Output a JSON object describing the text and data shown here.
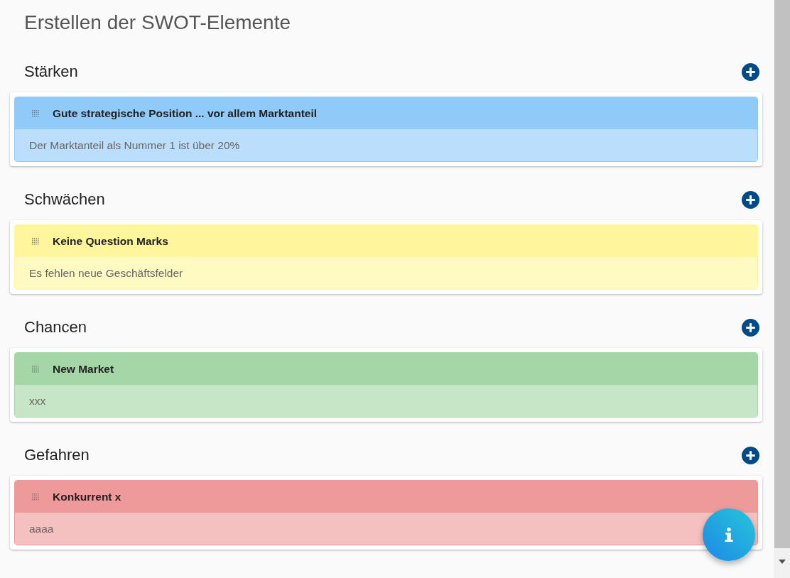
{
  "page_title": "Erstellen der SWOT-Elemente",
  "sections": [
    {
      "heading": "Stärken",
      "items": [
        {
          "title": "Gute strategische Position ... vor allem Marktanteil",
          "description": "Der Marktanteil als Nummer 1 ist über 20%",
          "color": "#90caf9"
        }
      ]
    },
    {
      "heading": "Schwächen",
      "items": [
        {
          "title": "Keine Question Marks",
          "description": "Es fehlen neue Geschäftsfelder",
          "color": "#fff59d"
        }
      ]
    },
    {
      "heading": "Chancen",
      "items": [
        {
          "title": "New Market",
          "description": "xxx",
          "color": "#a5d6a7"
        }
      ]
    },
    {
      "heading": "Gefahren",
      "items": [
        {
          "title": "Konkurrent x",
          "description": "aaaa",
          "color": "#ef9a9a"
        }
      ]
    }
  ]
}
